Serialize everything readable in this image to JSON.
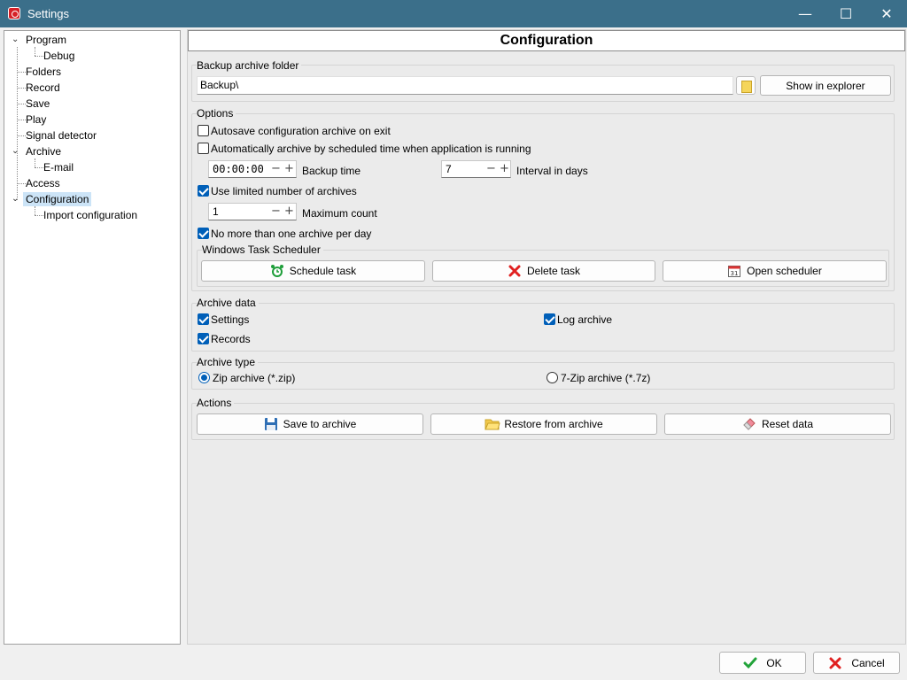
{
  "window": {
    "title": "Settings",
    "minimize": "—",
    "maximize": "☐",
    "close": "✕"
  },
  "tree": {
    "items": [
      {
        "label": "Program"
      },
      {
        "label": "Debug"
      },
      {
        "label": "Folders"
      },
      {
        "label": "Record"
      },
      {
        "label": "Save"
      },
      {
        "label": "Play"
      },
      {
        "label": "Signal detector"
      },
      {
        "label": "Archive"
      },
      {
        "label": "E-mail"
      },
      {
        "label": "Access"
      },
      {
        "label": "Configuration"
      },
      {
        "label": "Import configuration"
      }
    ],
    "selected": "Configuration"
  },
  "header": {
    "title": "Configuration"
  },
  "backup_folder": {
    "group_label": "Backup archive folder",
    "path": "Backup\\",
    "show_in_explorer": "Show in explorer"
  },
  "options": {
    "group_label": "Options",
    "autosave_label": "Autosave configuration archive on exit",
    "autosave_checked": false,
    "auto_archive_label": "Automatically archive by scheduled time when application is running",
    "auto_archive_checked": false,
    "backup_time_value": "00:00:00",
    "backup_time_label": "Backup time",
    "interval_value": "7",
    "interval_label": "Interval in days",
    "limited_label": "Use limited number of archives",
    "limited_checked": true,
    "max_count_value": "1",
    "max_count_label": "Maximum count",
    "one_per_day_label": "No more than one archive per day",
    "one_per_day_checked": true,
    "scheduler": {
      "group_label": "Windows Task Scheduler",
      "schedule_task": "Schedule task",
      "delete_task": "Delete task",
      "open_scheduler": "Open scheduler"
    }
  },
  "archive_data": {
    "group_label": "Archive data",
    "settings_label": "Settings",
    "settings_checked": true,
    "log_archive_label": "Log archive",
    "log_archive_checked": true,
    "records_label": "Records",
    "records_checked": true
  },
  "archive_type": {
    "group_label": "Archive type",
    "zip_label": "Zip archive (*.zip)",
    "sevenzip_label": "7-Zip archive (*.7z)",
    "selected": "zip"
  },
  "actions": {
    "group_label": "Actions",
    "save_to_archive": "Save to archive",
    "restore_from_archive": "Restore from archive",
    "reset_data": "Reset data"
  },
  "footer": {
    "ok": "OK",
    "cancel": "Cancel"
  },
  "colors": {
    "titlebar": "#3b6f8a",
    "accent": "#005fb8",
    "selection": "#cce4f7"
  },
  "spin_glyphs": {
    "minus": "−",
    "plus": "+"
  }
}
